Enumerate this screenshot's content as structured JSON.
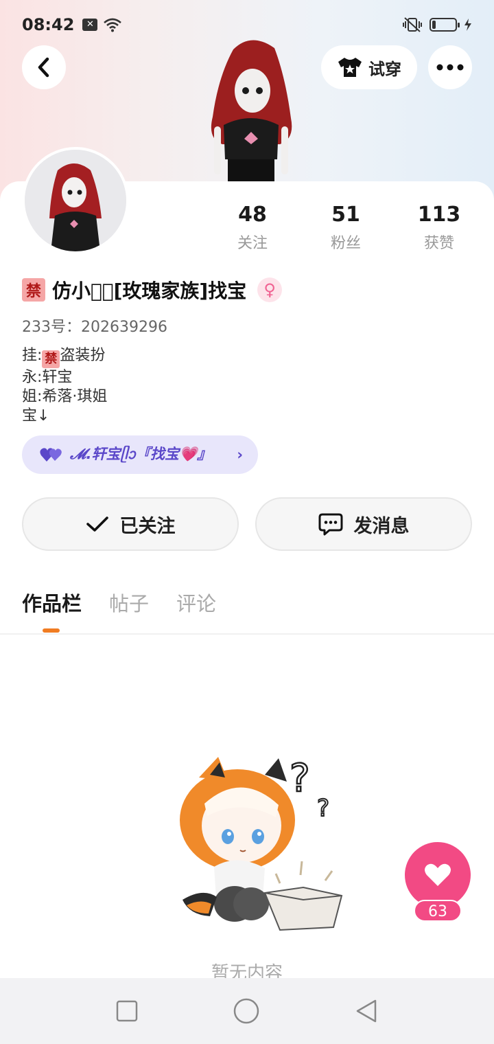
{
  "status_bar": {
    "time": "08:42",
    "notif_badge": "✕"
  },
  "header": {
    "try_on_label": "试穿",
    "more_dots": "•••"
  },
  "stats": [
    {
      "value": "48",
      "label": "关注"
    },
    {
      "value": "51",
      "label": "粉丝"
    },
    {
      "value": "113",
      "label": "获赞"
    }
  ],
  "profile": {
    "ban_badge": "禁",
    "nickname": "仿小鱼⃟[玫瑰家族]找宝",
    "gender_symbol": "♀",
    "uid": "233号：202639296",
    "bio_line1_prefix": "挂:",
    "bio_line1_badge": "禁",
    "bio_line1_suffix": "盗装扮",
    "bio_line2": "永:轩宝",
    "bio_line3": "姐:希落·琪姐",
    "bio_line4": "宝↓"
  },
  "family_tag": {
    "text": "𝓜.轩宝ᥫᩣ『找宝💗』",
    "chevron": "›"
  },
  "actions": {
    "follow_label": "已关注",
    "message_label": "发消息"
  },
  "tabs": [
    {
      "label": "作品栏",
      "active": true
    },
    {
      "label": "帖子",
      "active": false
    },
    {
      "label": "评论",
      "active": false
    }
  ],
  "empty_state": {
    "text": "暂无内容"
  },
  "like_fab": {
    "count": "63"
  },
  "colors": {
    "accent_orange": "#f07c22",
    "like_pink": "#f24a84",
    "family_purple": "#5a47c9"
  }
}
